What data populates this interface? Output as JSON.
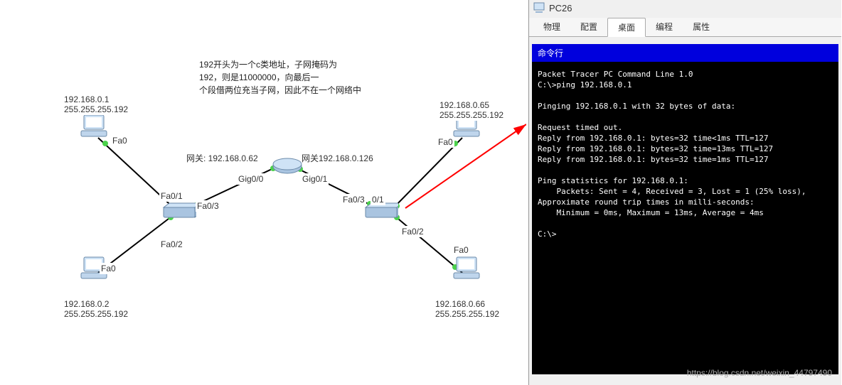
{
  "note": {
    "line1": "192开头为一个c类地址，子网掩码为",
    "line2": "192，则是11000000，向最后一",
    "line3": "个段借两位充当子网，因此不在一个网络中"
  },
  "gateways": {
    "left": "网关: 192.168.0.62",
    "right": "网关192.168.0.126"
  },
  "router_ports": {
    "g00": "Gig0/0",
    "g01": "Gig0/1"
  },
  "switch_left": {
    "fa01": "Fa0/1",
    "fa02": "Fa0/2",
    "fa03": "Fa0/3"
  },
  "switch_right": {
    "fa01": "0/1",
    "fa02": "Fa0/2",
    "fa03": "Fa0/3"
  },
  "pc": {
    "tl": {
      "ip": "192.168.0.1",
      "mask": "255.255.255.192",
      "port": "Fa0"
    },
    "bl": {
      "ip": "192.168.0.2",
      "mask": "255.255.255.192",
      "port": "Fa0"
    },
    "tr": {
      "ip": "192.168.0.65",
      "mask": "255.255.255.192",
      "port": "Fa0"
    },
    "br": {
      "ip": "192.168.0.66",
      "mask": "255.255.255.192",
      "port": "Fa0"
    }
  },
  "panel": {
    "title": "PC26",
    "tabs": {
      "t1": "物理",
      "t2": "配置",
      "t3": "桌面",
      "t4": "编程",
      "t5": "属性"
    },
    "bluebar": "命令行",
    "terminal": "Packet Tracer PC Command Line 1.0\nC:\\>ping 192.168.0.1\n\nPinging 192.168.0.1 with 32 bytes of data:\n\nRequest timed out.\nReply from 192.168.0.1: bytes=32 time<1ms TTL=127\nReply from 192.168.0.1: bytes=32 time=13ms TTL=127\nReply from 192.168.0.1: bytes=32 time=1ms TTL=127\n\nPing statistics for 192.168.0.1:\n    Packets: Sent = 4, Received = 3, Lost = 1 (25% loss),\nApproximate round trip times in milli-seconds:\n    Minimum = 0ms, Maximum = 13ms, Average = 4ms\n\nC:\\>"
  },
  "watermark": "https://blog.csdn.net/weixin_44797490"
}
